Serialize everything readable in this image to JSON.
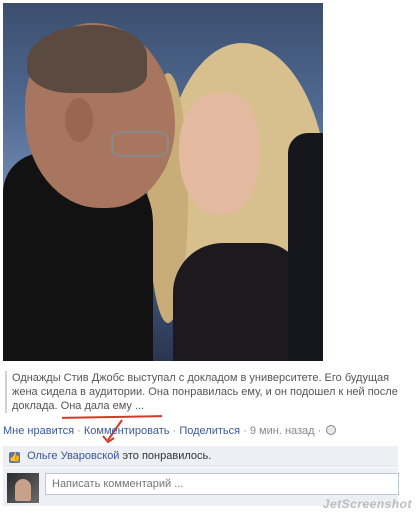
{
  "post": {
    "text": "Однажды Стив Джобс выступал с докладом в университете. Его будущая жена сидела в аудитории. Она понравилась ему, и он подошел к ней после доклада. Она дала ему ..."
  },
  "actions": {
    "like": "Мне нравится",
    "comment": "Комментировать",
    "share": "Поделиться",
    "time": "9 мин. назад",
    "separator": "·"
  },
  "likes": {
    "user": "Ольге Уваровской",
    "suffix": "это понравилось."
  },
  "comment_box": {
    "placeholder": "Написать комментарий ..."
  },
  "watermark": "JetScreenshot",
  "annotation_color": "#d23a2a",
  "link_color": "#3b5998"
}
